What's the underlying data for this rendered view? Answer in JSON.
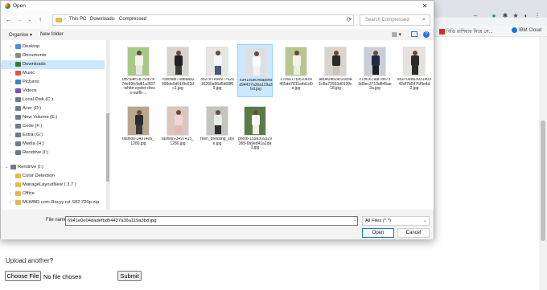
{
  "dialog": {
    "title": "Open",
    "address": {
      "crumbs": [
        "This PC",
        "Downloads",
        "Compressed"
      ]
    },
    "search_placeholder": "Search Compressed",
    "toolbar": {
      "organise": "Organise ▾",
      "new_folder": "New folder"
    }
  },
  "nav_items": [
    {
      "label": "Desktop",
      "icon": "desktop-folder-icon",
      "color": "#4a90d9",
      "expandable": true
    },
    {
      "label": "Documents",
      "icon": "documents-icon",
      "color": "#8b8b8b",
      "expandable": true
    },
    {
      "label": "Downloads",
      "icon": "download-icon",
      "color": "#2e7d32",
      "expandable": true,
      "selected": true
    },
    {
      "label": "Music",
      "icon": "music-icon",
      "color": "#e5534b",
      "expandable": true
    },
    {
      "label": "Pictures",
      "icon": "pictures-icon",
      "color": "#3b82c4",
      "expandable": true
    },
    {
      "label": "Videos",
      "icon": "videos-icon",
      "color": "#7b4fc4",
      "expandable": true
    },
    {
      "label": "Local Disk (C:)",
      "icon": "drive-icon",
      "color": "#6f7b86",
      "expandable": true
    },
    {
      "label": "Acer (D:)",
      "icon": "drive-icon",
      "color": "#6f7b86",
      "expandable": true
    },
    {
      "label": "New Volume (E:)",
      "icon": "drive-icon",
      "color": "#6f7b86",
      "expandable": true
    },
    {
      "label": "Code (F:)",
      "icon": "drive-icon",
      "color": "#6f7b86",
      "expandable": true
    },
    {
      "label": "Extra (G:)",
      "icon": "drive-icon",
      "color": "#6f7b86",
      "expandable": true
    },
    {
      "label": "Media (H:)",
      "icon": "drive-icon",
      "color": "#6f7b86",
      "expandable": true
    },
    {
      "label": "Rendrive (I:)",
      "icon": "drive-icon",
      "color": "#6f7b86",
      "expandable": true
    },
    {
      "label": "Rendrive (I:)",
      "icon": "drive-icon",
      "color": "#6f7b86",
      "expandable": true,
      "expanded": true
    },
    {
      "label": "Color Detection",
      "icon": "folder-icon",
      "color": "#e8b94a",
      "expandable": false
    },
    {
      "label": "ManageLayoutNew ( 3.7 )",
      "icon": "folder-icon",
      "color": "#e8b94a",
      "expandable": true
    },
    {
      "label": "Office",
      "icon": "folder-icon",
      "color": "#e8b94a",
      "expandable": true
    },
    {
      "label": "MLWBD.com Rocyy rst S02 720p.zip",
      "icon": "folder-icon",
      "color": "#e8b94a",
      "expandable": true
    }
  ],
  "files": [
    {
      "name": "0d75afc18753c7474e99fc9d81a3f37--white-eyelet-dress-outfit-...",
      "bg": "#a6c98a",
      "top": "#f2f2f0",
      "bottom": "#e9e6e1"
    },
    {
      "name": "75dcd8e73dbaa92096de0d91f9c63dc1.jpg",
      "bg": "#d7d4cf",
      "top": "#202020",
      "bottom": "#3a3a3a"
    },
    {
      "name": "3527e7e9e97762616260a96d5d68f09.jpg",
      "bg": "#e7e6e3",
      "top": "#f5f5f5",
      "bottom": "#4b5a78"
    },
    {
      "name": "6941e0e04dadefbd94437a36a119a3bd.jpg",
      "bg": "#d9e1e6",
      "top": "#fafafa",
      "bottom": "#f2f2f2",
      "selected": true
    },
    {
      "name": "1706617f3c104c4465dd7811a4d1d0e.jpg",
      "bg": "#b8c68f",
      "top": "#f4f2ec",
      "bottom": "#efece6"
    },
    {
      "name": "ab0e04824c20c8a1c8a73933d0199c18.jpg",
      "bg": "#d8d4ce",
      "top": "#2b2b2b",
      "bottom": "#c9c4bb"
    },
    {
      "name": "c78f1679af78673 9d0ec3713d845ae3a.jpg",
      "bg": "#c9ced6",
      "top": "#1f2a44",
      "bottom": "#1e1e1e"
    },
    {
      "name": "e6070ee6393140342df7b5476f9e4d2.jpg",
      "bg": "#e5e2de",
      "top": "#2a2a2a",
      "bottom": "#2a2a2a"
    },
    {
      "name": "fashion-3497406_1280.jpg",
      "bg": "#b9a68d",
      "top": "#2a2a2a",
      "bottom": "#3b3b3b"
    },
    {
      "name": "fashion-3497415_1280.jpg",
      "bg": "#d9c6bd",
      "top": "#f2d6d6",
      "bottom": "#e7b8b8"
    },
    {
      "name": "men_dressing_style.jpg",
      "bg": "#c3c6c0",
      "top": "#eceae6",
      "bottom": "#2f2f2f"
    },
    {
      "name": "photo-1599309329365-0a9ed41a1da3.jpg",
      "bg": "#5a7a46",
      "top": "#f7f7f4",
      "bottom": "#f1efe9"
    }
  ],
  "bottom": {
    "file_name_label": "File name:",
    "file_name_value": "6941e0e04dadefbd94437a36a119a3bd.jpg",
    "file_type": "All Files (*.*)",
    "open_label": "Open",
    "cancel_label": "Cancel"
  },
  "bookmarks": [
    {
      "label": "বিডি রাশিয়ার নিয়ে সে...",
      "icon": "bookmark-flag-icon"
    },
    {
      "label": "IBM Cloud",
      "icon": "ibm-cloud-icon"
    }
  ],
  "page": {
    "upload_another": "Upload another?",
    "choose_file": "Choose File",
    "no_file": "No file chosen",
    "submit": "Submit"
  }
}
